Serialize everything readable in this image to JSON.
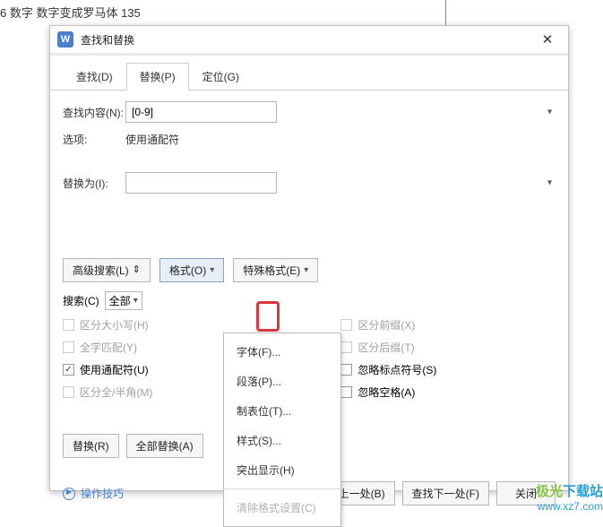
{
  "page_top_text": "6 数字  数字变成罗马体 135",
  "dialog": {
    "title": "查找和替换",
    "close": "✕",
    "tabs": {
      "find": "查找(D)",
      "replace": "替换(P)",
      "goto": "定位(G)"
    },
    "search_label": "查找内容(N):",
    "search_value": "[0-9]",
    "options_label": "选项:",
    "options_value": "使用通配符",
    "replace_label": "替换为(I):",
    "replace_value": "",
    "adv_search_btn": "高级搜索(L)",
    "format_btn": "格式(O)",
    "special_btn": "特殊格式(E)",
    "scope_label": "搜索(C)",
    "scope_value": "全部",
    "checkboxes_left": [
      {
        "label": "区分大小写(H)",
        "checked": false,
        "disabled": true
      },
      {
        "label": "全字匹配(Y)",
        "checked": false,
        "disabled": true
      },
      {
        "label": "使用通配符(U)",
        "checked": true,
        "disabled": false
      },
      {
        "label": "区分全/半角(M)",
        "checked": false,
        "disabled": true
      }
    ],
    "checkboxes_right": [
      {
        "label": "区分前缀(X)",
        "checked": false,
        "disabled": true
      },
      {
        "label": "区分后缀(T)",
        "checked": false,
        "disabled": true
      },
      {
        "label": "忽略标点符号(S)",
        "checked": false,
        "disabled": false
      },
      {
        "label": "忽略空格(A)",
        "checked": false,
        "disabled": false
      }
    ],
    "format_menu": {
      "font": "字体(F)...",
      "paragraph": "段落(P)...",
      "tabs": "制表位(T)...",
      "style": "样式(S)...",
      "highlight": "突出显示(H)",
      "clear": "清除格式设置(C)"
    },
    "footer": {
      "replace": "替换(R)",
      "replace_all": "全部替换(A)",
      "tips": "操作技巧",
      "find_prev": "查找上一处(B)",
      "find_next": "查找下一处(F)",
      "close": "关闭"
    }
  },
  "watermark": {
    "line1a": "极光",
    "line1b": "下载站",
    "line2": "www.xz7.com"
  }
}
